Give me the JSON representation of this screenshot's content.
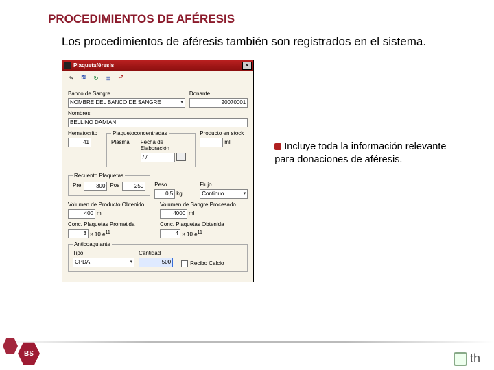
{
  "title": "PROCEDIMIENTOS DE AFÉRESIS",
  "subtitle": "Los procedimientos de aféresis también son registrados en el sistema.",
  "note": "Incluye toda la información relevante para donaciones de aféresis.",
  "window": {
    "title": "Plaquetaféresis",
    "close": "×",
    "fields": {
      "banco_lbl": "Banco de Sangre",
      "banco_val": "NOMBRE DEL BANCO DE SANGRE",
      "donante_lbl": "Donante",
      "donante_val": "20070001",
      "nombres_lbl": "Nombres",
      "nombres_val": "BELLINO DAMIAN",
      "hematocrito_lbl": "Hematocrito",
      "hematocrito_val": "41",
      "grp_plaq": "Plaquetoconcentradas",
      "plasma_lbl": "Plasma",
      "fecha_lbl": "Fecha de Elaboración",
      "fecha_val": "/ /",
      "prod_lbl": "Producto en stock",
      "prod_unit": "ml",
      "grp_rec": "Recuento Plaquetas",
      "pre_lbl": "Pre",
      "pre_val": "300",
      "pos_lbl": "Pos",
      "pos_val": "250",
      "peso_lbl": "Peso",
      "peso_val": "0,5",
      "peso_unit": "kg",
      "flujo_lbl": "Flujo",
      "flujo_val": "Continuo",
      "vol_obt_lbl": "Volumen de Producto Obtenido",
      "vol_obt_val": "400",
      "vol_obt_unit": "ml",
      "vol_proc_lbl": "Volumen de Sangre Procesado",
      "vol_proc_val": "4000",
      "vol_proc_unit": "ml",
      "conc_prom_lbl": "Conc. Plaquetas Prometida",
      "conc_prom_val": "3",
      "conc_obt_lbl": "Conc. Plaquetas Obtenida",
      "conc_obt_val": "4",
      "conc_unit_a": "× 10 e",
      "conc_unit_b": "11",
      "grp_anti": "Anticoagulante",
      "tipo_lbl": "Tipo",
      "tipo_val": "CPDA",
      "cant_lbl": "Cantidad",
      "cant_val": "500",
      "recibo_lbl": "Recibo Calcio"
    }
  },
  "footer": {
    "bs": "BS",
    "th": "th"
  }
}
